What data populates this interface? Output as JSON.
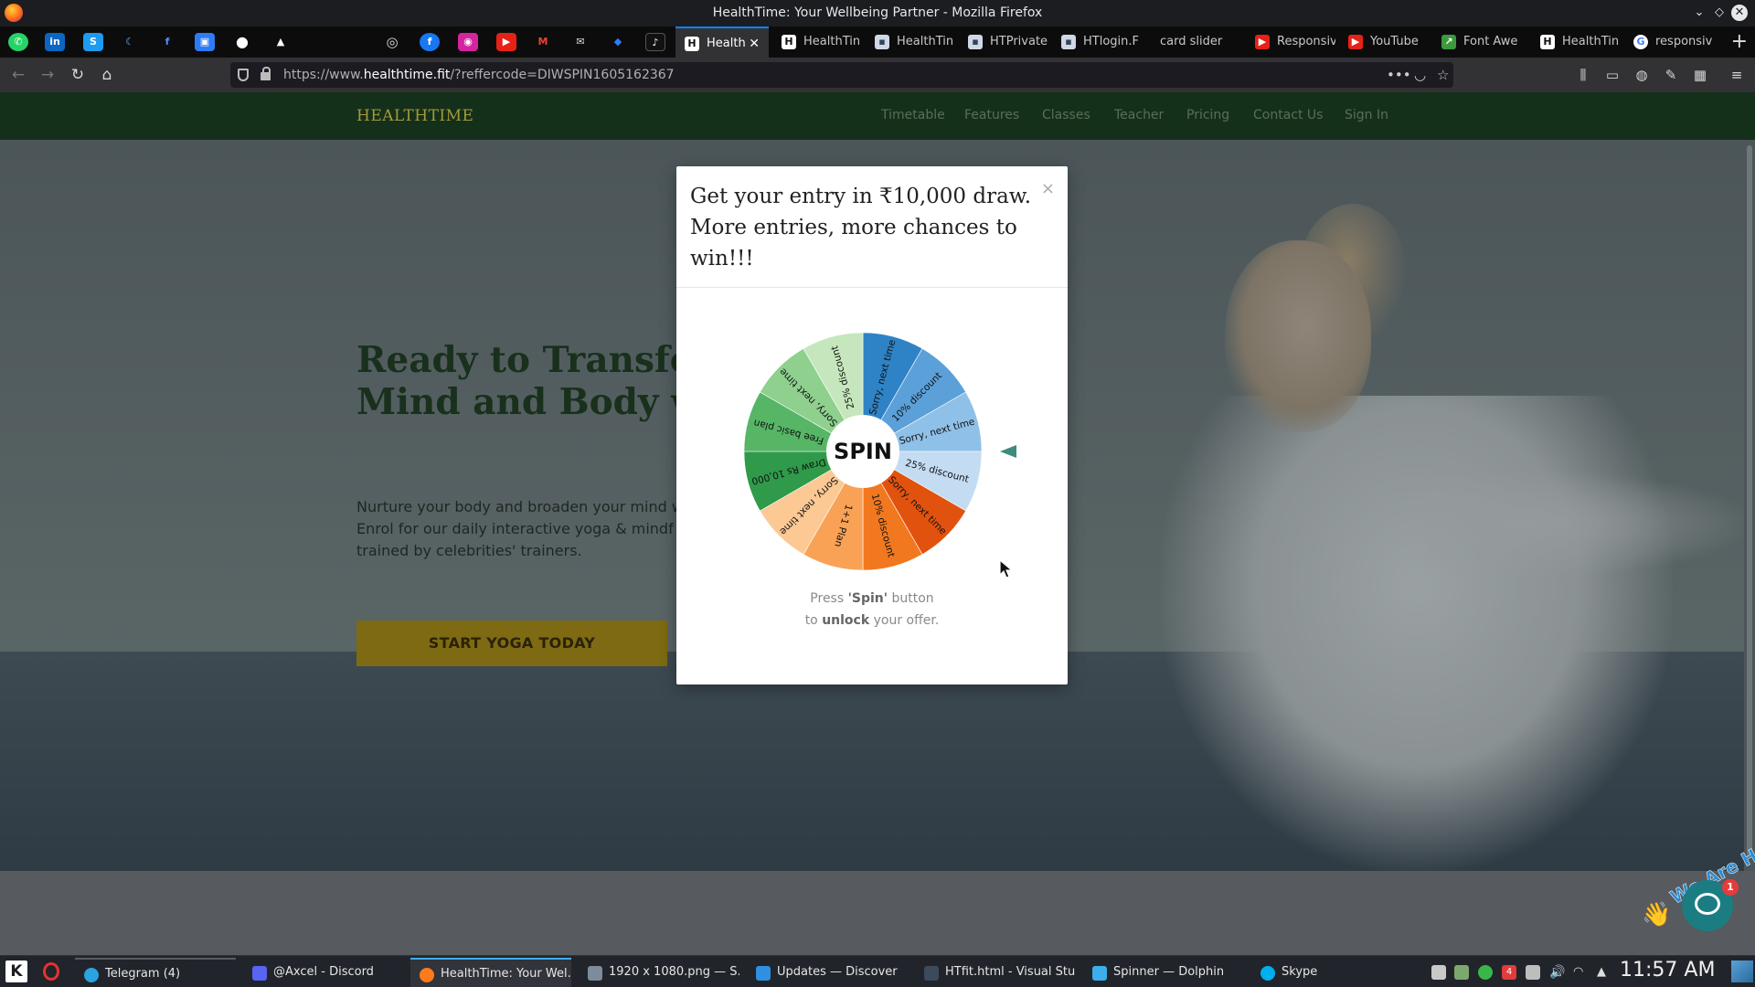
{
  "window": {
    "title": "HealthTime: Your Wellbeing Partner - Mozilla Firefox"
  },
  "tabs": [
    {
      "label": "Health",
      "active": true
    },
    {
      "label": "HealthTin"
    },
    {
      "label": "HealthTin"
    },
    {
      "label": "HTPrivate"
    },
    {
      "label": "HTlogin.F"
    },
    {
      "label": "card slider"
    },
    {
      "label": "Responsiv"
    },
    {
      "label": "YouTube"
    },
    {
      "label": "Font Awe"
    },
    {
      "label": "HealthTin"
    },
    {
      "label": "responsiv"
    }
  ],
  "navbar": {
    "url_prefix": "https://www.",
    "url_host": "healthtime.fit",
    "url_rest": "/?reffercode=DIWSPIN1605162367"
  },
  "site": {
    "brand": "HEALTHTIME",
    "nav": [
      "Timetable",
      "Features",
      "Classes",
      "Teacher",
      "Pricing",
      "Contact Us",
      "Sign In"
    ],
    "hero_title_line1": "Ready to Transform",
    "hero_title_line2": "Mind and Body wit",
    "hero_text_line1": "Nurture your body and broaden your mind w",
    "hero_text_line2": "Enrol for our daily interactive yoga & mindf",
    "hero_text_line3": "trained by celebrities' trainers.",
    "cta": "START YOGA TODAY"
  },
  "modal": {
    "title": "Get your entry in ₹10,000 draw. More entries, more chances to win!!!",
    "close": "×",
    "spin": "SPIN",
    "instruction_pre": "Press ",
    "instruction_bold1": "'Spin'",
    "instruction_mid": " button",
    "instruction_line2_pre": "to ",
    "instruction_bold2": "unlock",
    "instruction_post": " your offer."
  },
  "wheel": {
    "segments": [
      {
        "label": "Sorry, next time",
        "color": "#2e83c6"
      },
      {
        "label": "10% discount",
        "color": "#5ba0d9"
      },
      {
        "label": "Sorry, next time",
        "color": "#8fc0e8"
      },
      {
        "label": "25% discount",
        "color": "#c4dcf2"
      },
      {
        "label": "Sorry, next time",
        "color": "#e2520f"
      },
      {
        "label": "10% discount",
        "color": "#f2781f"
      },
      {
        "label": "1+1 Plan",
        "color": "#f9a256"
      },
      {
        "label": "Sorry, next time",
        "color": "#fcc893"
      },
      {
        "label": "Draw Rs 10,000",
        "color": "#2f9a4a"
      },
      {
        "label": "Free basic plan",
        "color": "#57b566"
      },
      {
        "label": "Sorry, next time",
        "color": "#8fd08f"
      },
      {
        "label": "25% discount",
        "color": "#c6e7bd"
      }
    ]
  },
  "chat": {
    "label": "We Are Here!",
    "badge": "1"
  },
  "taskbar": {
    "items": [
      {
        "label": "Telegram (4)"
      },
      {
        "label": "@Axcel - Discord"
      },
      {
        "label": "HealthTime: Your Wel...",
        "active": true
      },
      {
        "label": "1920 x 1080.png — S..."
      },
      {
        "label": "Updates — Discover"
      },
      {
        "label": "HTfit.html - Visual Stu..."
      },
      {
        "label": "Spinner — Dolphin"
      },
      {
        "label": "Skype"
      }
    ],
    "clock": "11:57 AM",
    "tray_badge": "4"
  }
}
